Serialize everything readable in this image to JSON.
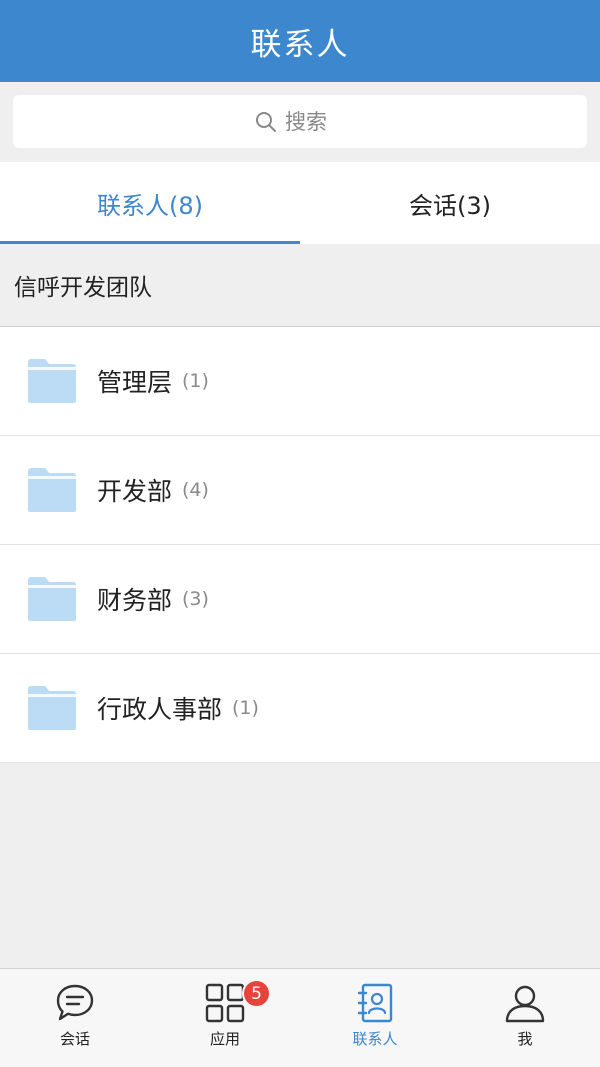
{
  "header": {
    "title": "联系人"
  },
  "search": {
    "placeholder": "搜索",
    "icon": "search-icon"
  },
  "tabs": [
    {
      "label": "联系人(8)",
      "active": true
    },
    {
      "label": "会话(3)",
      "active": false
    }
  ],
  "group": {
    "title": "信呼开发团队"
  },
  "departments": [
    {
      "name": "管理层",
      "count": "(1)",
      "icon": "folder-icon"
    },
    {
      "name": "开发部",
      "count": "(4)",
      "icon": "folder-icon"
    },
    {
      "name": "财务部",
      "count": "(3)",
      "icon": "folder-icon"
    },
    {
      "name": "行政人事部",
      "count": "(1)",
      "icon": "folder-icon"
    }
  ],
  "tabbar": [
    {
      "label": "会话",
      "icon": "chat-bubble-icon",
      "active": false
    },
    {
      "label": "应用",
      "icon": "grid-apps-icon",
      "active": false,
      "badge": "5"
    },
    {
      "label": "联系人",
      "icon": "contacts-book-icon",
      "active": true
    },
    {
      "label": "我",
      "icon": "user-icon",
      "active": false
    }
  ],
  "colors": {
    "primary": "#3d87cf",
    "badge": "#e8433b",
    "folder": "#bcdcf5"
  }
}
